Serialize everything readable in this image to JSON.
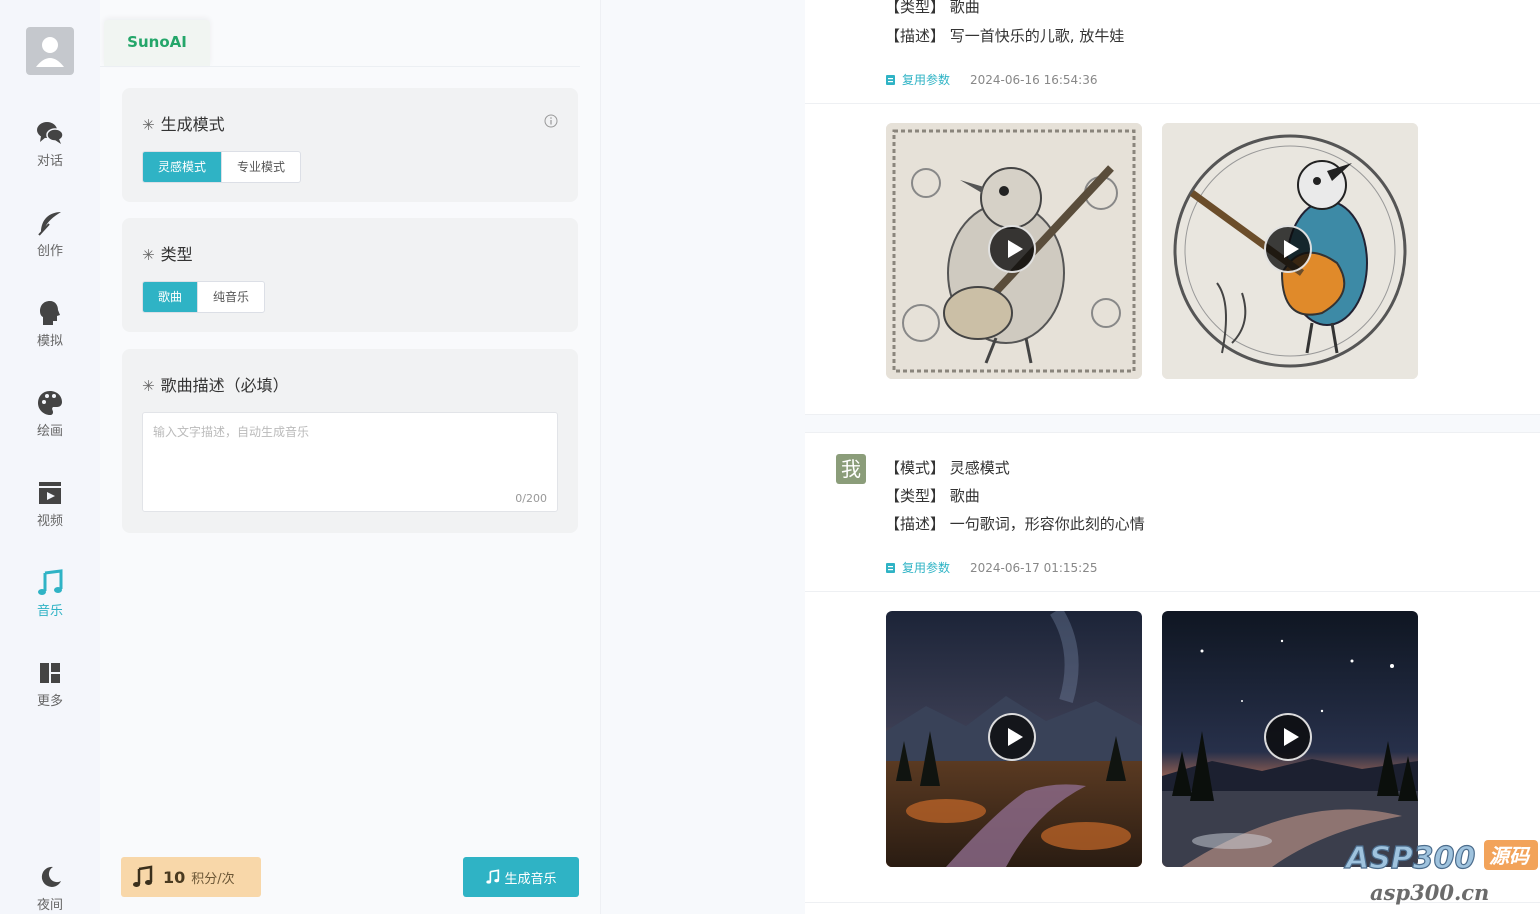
{
  "nav": {
    "items": [
      {
        "label": "对话",
        "icon": "chat-icon"
      },
      {
        "label": "创作",
        "icon": "feather-icon"
      },
      {
        "label": "模拟",
        "icon": "head-icon"
      },
      {
        "label": "绘画",
        "icon": "palette-icon"
      },
      {
        "label": "视频",
        "icon": "film-icon"
      },
      {
        "label": "音乐",
        "icon": "music-note-icon",
        "active": true
      },
      {
        "label": "更多",
        "icon": "grid-icon"
      }
    ],
    "night_label": "夜间"
  },
  "panel": {
    "brand_tab": "SunoAI",
    "mode": {
      "title": "生成模式",
      "options": [
        "灵感模式",
        "专业模式"
      ],
      "selected": "灵感模式"
    },
    "type": {
      "title": "类型",
      "options": [
        "歌曲",
        "纯音乐"
      ],
      "selected": "歌曲"
    },
    "description": {
      "title": "歌曲描述（必填）",
      "placeholder": "输入文字描述，自动生成音乐",
      "count": "0/200"
    },
    "cost": {
      "value": "10",
      "unit": "积分/次"
    },
    "generate_label": "生成音乐"
  },
  "feed": {
    "entries": [
      {
        "desc_label": "【描述】",
        "desc_value": "写一首快乐的儿歌, 放牛娃",
        "reuse_label": "复用参数",
        "timestamp": "2024-06-16 16:54:36",
        "thumbs": [
          "bird-guitar-ornate",
          "bird-guitar-blue"
        ]
      },
      {
        "avatar": "我",
        "mode_label": "【模式】",
        "mode_value": "灵感模式",
        "type_label": "【类型】",
        "type_value": "歌曲",
        "desc_label": "【描述】",
        "desc_value": "一句歌词，形容你此刻的心情",
        "reuse_label": "复用参数",
        "timestamp": "2024-06-17 01:15:25",
        "thumbs": [
          "night-valley-river",
          "night-snow-river"
        ]
      }
    ]
  },
  "watermark": {
    "logo_text": "ASP300",
    "tag": "源码",
    "url": "asp300.cn"
  },
  "colors": {
    "accent": "#2fb3c5",
    "brand_green": "#24a66a",
    "cost_bg": "#f8d7a9"
  }
}
